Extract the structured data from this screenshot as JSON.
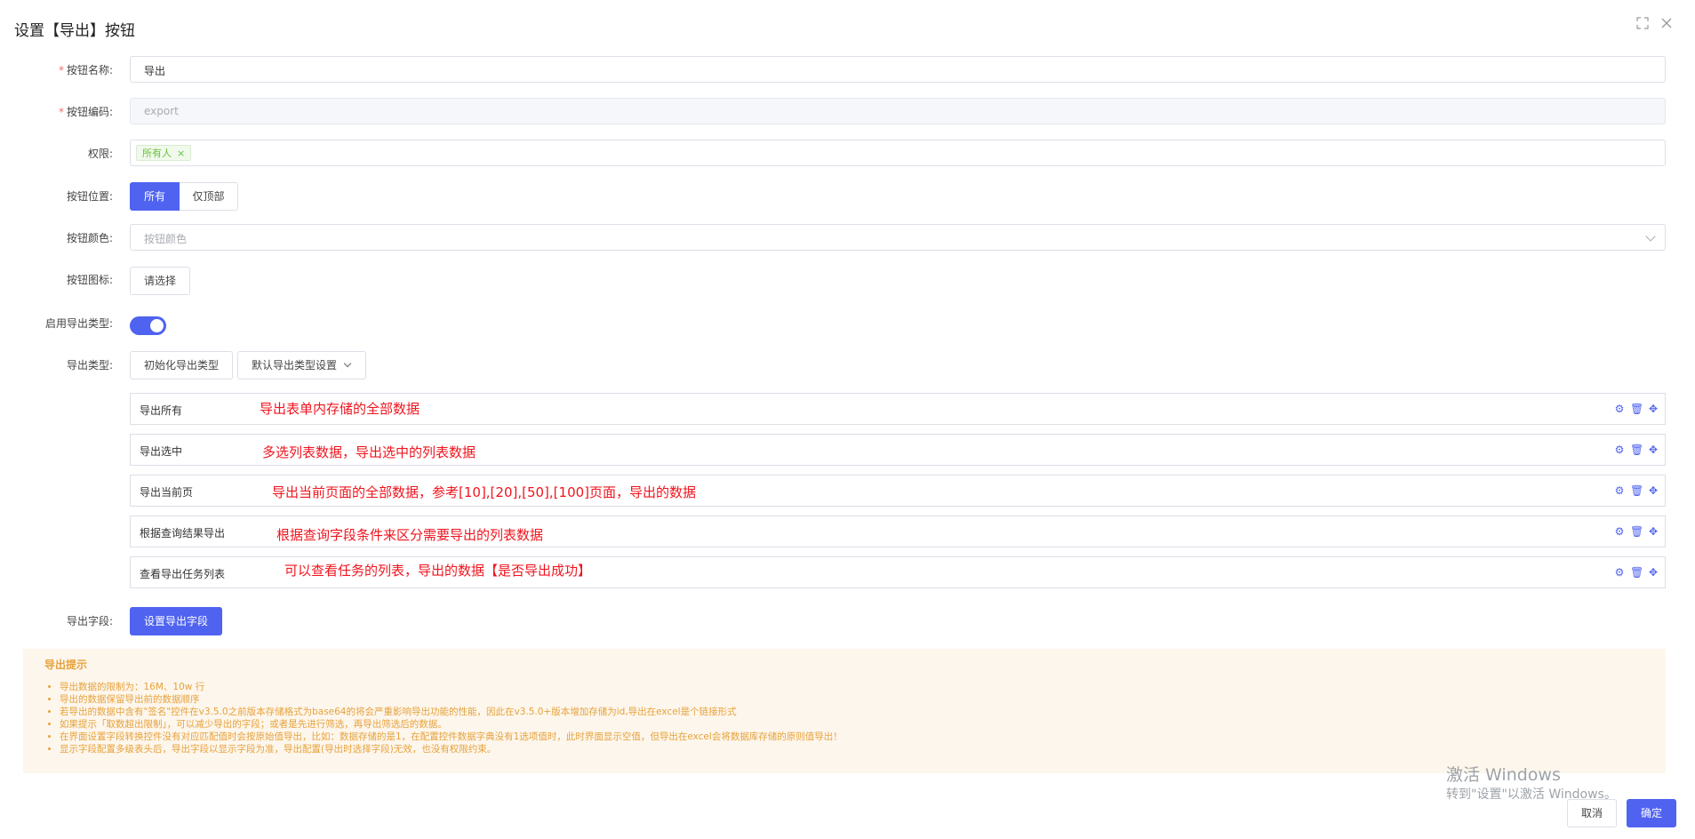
{
  "dialog": {
    "title": "设置【导出】按钮",
    "fullscreen_icon": "fullscreen-icon",
    "close_icon": "close-icon"
  },
  "form": {
    "button_name": {
      "label": "按钮名称:",
      "value": "导出",
      "required": true
    },
    "button_code": {
      "label": "按钮编码:",
      "value": "export",
      "required": true,
      "disabled": true
    },
    "permission": {
      "label": "权限:",
      "tags": [
        "所有人"
      ]
    },
    "position": {
      "label": "按钮位置:",
      "options": [
        "所有",
        "仅顶部"
      ],
      "selected": "所有"
    },
    "color": {
      "label": "按钮颜色:",
      "placeholder": "按钮颜色"
    },
    "icon": {
      "label": "按钮图标:",
      "button": "请选择"
    },
    "enable_export_type": {
      "label": "启用导出类型:",
      "on": true
    },
    "export_type": {
      "label": "导出类型:",
      "init_button": "初始化导出类型",
      "default_button": "默认导出类型设置",
      "rows": [
        {
          "label": "导出所有",
          "note": "导出表单内存储的全部数据"
        },
        {
          "label": "导出选中",
          "note": "多选列表数据，导出选中的列表数据"
        },
        {
          "label": "导出当前页",
          "note": "导出当前页面的全部数据，参考[10],[20],[50],[100]页面，导出的数据"
        },
        {
          "label": "根据查询结果导出",
          "note": "根据查询字段条件来区分需要导出的列表数据"
        },
        {
          "label": "查看导出任务列表",
          "note": "可以查看任务的列表，导出的数据【是否导出成功】"
        }
      ],
      "row_icons": [
        "gear-icon",
        "trash-icon",
        "move-icon"
      ]
    },
    "export_fields": {
      "label": "导出字段:",
      "button": "设置导出字段"
    }
  },
  "tips": {
    "title": "导出提示",
    "items": [
      "导出数据的限制为：16M、10w 行",
      "导出的数据保留导出前的数据顺序",
      "若导出的数据中含有\"签名\"控件在v3.5.0之前版本存储格式为base64的将会严重影响导出功能的性能，因此在v3.5.0+版本增加存储为id,导出在excel是个链接形式",
      "如果提示「取数超出限制」，可以减少导出的字段；或者是先进行筛选，再导出筛选后的数据。",
      "在界面设置字段转换控件没有对应匹配值时会按原始值导出，比如：数据存储的是1，在配置控件数据字典没有1选项值时，此时界面显示空值，但导出在excel会将数据库存储的原则值导出！",
      "显示字段配置多级表头后，导出字段以显示字段为准，导出配置(导出时选择字段)无效，也没有权限约束。"
    ]
  },
  "footer": {
    "cancel": "取消",
    "confirm": "确定"
  },
  "watermark": {
    "line1": "激活 Windows",
    "line2": "转到\"设置\"以激活 Windows。"
  },
  "colors": {
    "primary": "#4f63f0",
    "note_red": "#f0141e",
    "tip_bg": "#fdf6ec",
    "tip_text": "#e6a23c",
    "tag_green": "#67c23a"
  }
}
